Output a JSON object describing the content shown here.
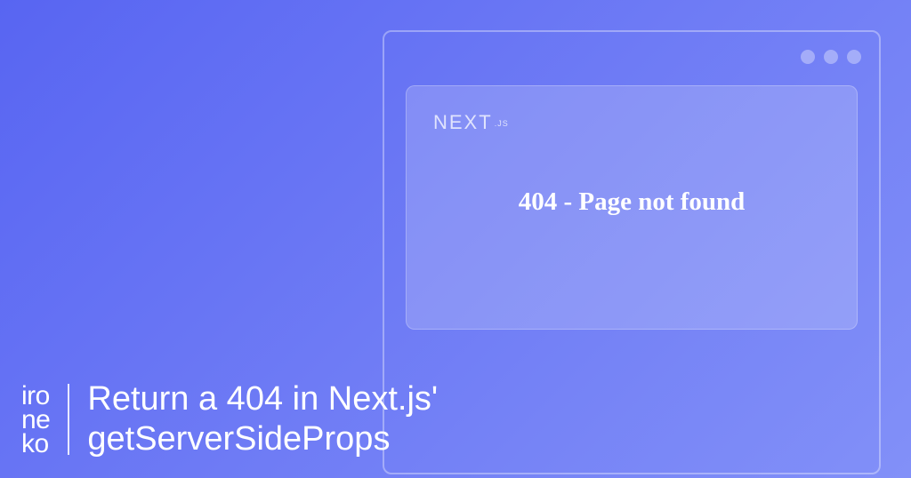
{
  "window": {
    "logo_text": "NEXT",
    "logo_suffix": ".JS",
    "error_text": "404 - Page not found"
  },
  "footer": {
    "logo_line1": "iro",
    "logo_line2": "ne",
    "logo_line3": "ko",
    "title_line1": "Return a 404 in Next.js'",
    "title_line2": "getServerSideProps"
  }
}
